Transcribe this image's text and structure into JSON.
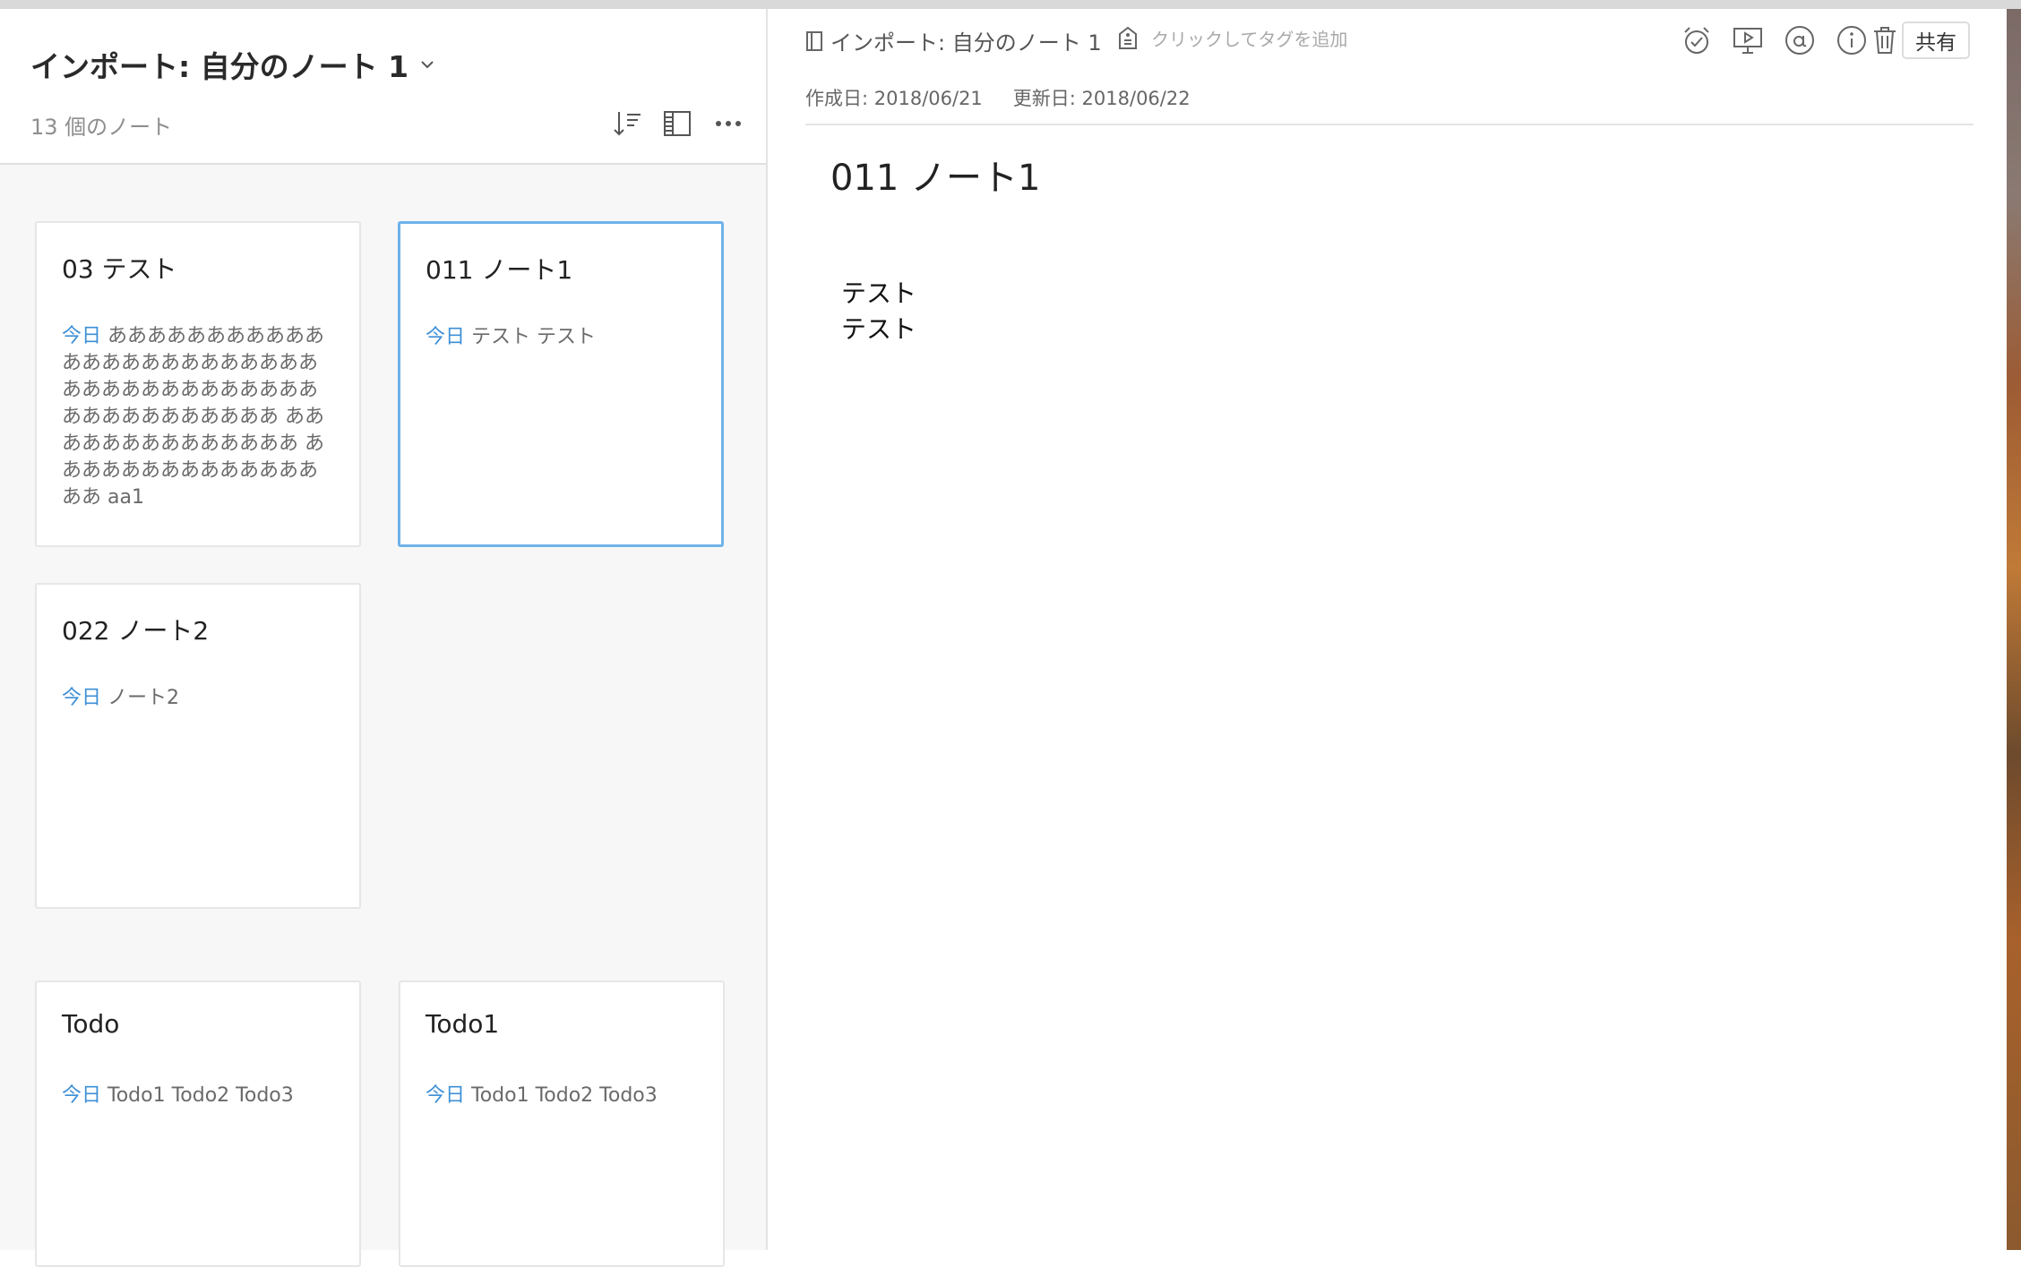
{
  "notebook": {
    "title": "インポート: 自分のノート 1",
    "note_count": "13 個のノート"
  },
  "notes": [
    {
      "title": "03 テスト",
      "date": "今日",
      "snippet": "ああああああああああああああああああああああああああああああああああああああああああああああああ ああああああああああああああ ああああああああああああああああ aa1"
    },
    {
      "title": "011 ノート1",
      "date": "今日",
      "snippet": "テスト テスト",
      "selected": true
    },
    {
      "title": "022 ノート2",
      "date": "今日",
      "snippet": "ノート2"
    },
    {
      "title": "Todo",
      "date": "今日",
      "snippet": "Todo1 Todo2 Todo3"
    },
    {
      "title": "Todo1",
      "date": "今日",
      "snippet": "Todo1 Todo2 Todo3"
    }
  ],
  "editor": {
    "notebook_crumb": "インポート: 自分のノート 1",
    "tag_placeholder": "クリックしてタグを追加",
    "created": "作成日: 2018/06/21",
    "updated": "更新日: 2018/06/22",
    "share_label": "共有",
    "title": "011 ノート1",
    "body_lines": [
      "テスト",
      "テスト"
    ]
  },
  "icons": {
    "header": [
      "sort-icon",
      "view-toggle-icon",
      "more-icon"
    ],
    "toolbar": [
      "reminder-icon",
      "present-icon",
      "mention-icon",
      "info-icon",
      "trash-icon"
    ]
  },
  "colors": {
    "accent": "#3d8fd6",
    "selected_border": "#6eb2ea"
  }
}
